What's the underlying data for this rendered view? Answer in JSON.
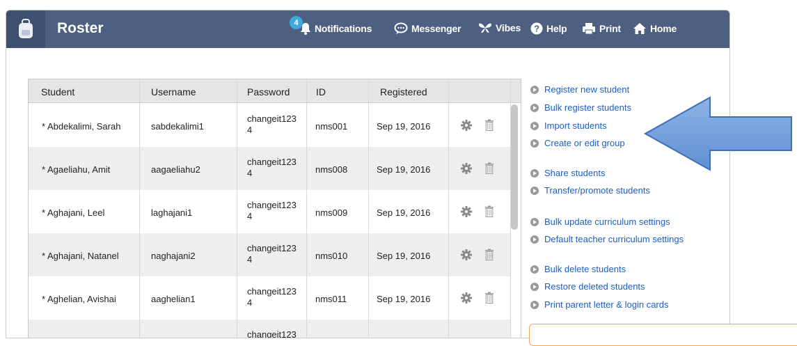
{
  "header": {
    "title": "Roster",
    "notifications_count": "4",
    "nav": {
      "notifications": "Notifications",
      "messenger": "Messenger",
      "vibes": "Vibes",
      "help": "Help",
      "print": "Print",
      "home": "Home"
    },
    "colors": {
      "bar": "#4e6082",
      "logo_bg": "#3f506f",
      "badge": "#3fa8e0"
    }
  },
  "table": {
    "columns": [
      "Student",
      "Username",
      "Password",
      "ID",
      "Registered"
    ],
    "rows": [
      {
        "student": "* Abdekalimi, Sarah",
        "username": "sabdekalimi1",
        "password": "changeit123\n4",
        "id": "nms001",
        "registered": "Sep 19, 2016"
      },
      {
        "student": "* Agaeliahu, Amit",
        "username": "aagaeliahu2",
        "password": "changeit123\n4",
        "id": "nms008",
        "registered": "Sep 19, 2016"
      },
      {
        "student": "* Aghajani, Leel",
        "username": "laghajani1",
        "password": "changeit123\n4",
        "id": "nms009",
        "registered": "Sep 19, 2016"
      },
      {
        "student": "* Aghajani, Natanel",
        "username": "naghajani2",
        "password": "changeit123\n4",
        "id": "nms010",
        "registered": "Sep 19, 2016"
      },
      {
        "student": "* Aghelian, Avishai",
        "username": "aaghelian1",
        "password": "changeit123\n4",
        "id": "nms011",
        "registered": "Sep 19, 2016"
      },
      {
        "student": "",
        "username": "",
        "password": "changeit123",
        "id": "",
        "registered": ""
      }
    ]
  },
  "actions": [
    "Register new student",
    "Bulk register students",
    "Import students",
    "Create or edit group",
    "Share students",
    "Transfer/promote students",
    "Bulk update curriculum settings",
    "Default teacher curriculum settings",
    "Bulk delete students",
    "Restore deleted students",
    "Print parent letter & login cards"
  ],
  "icons": {
    "logo": "backpack-icon",
    "notifications": "bell-icon",
    "messenger": "chat-bubble-icon",
    "vibes": "butterfly-icon",
    "help": "question-circle-icon",
    "print": "printer-icon",
    "home": "house-icon",
    "row_settings": "gear-icon",
    "row_delete": "trash-icon",
    "callout": "arrow-left-icon"
  }
}
